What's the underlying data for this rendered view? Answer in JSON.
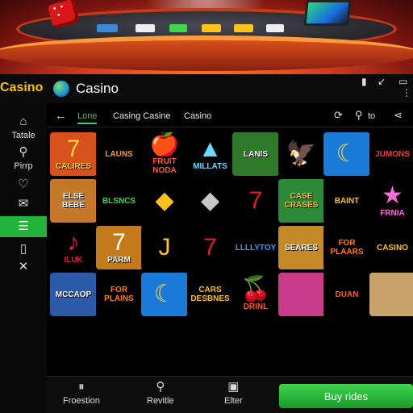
{
  "app": {
    "brand": "Casino",
    "title": "Casino"
  },
  "window": {
    "controls": [
      "▮",
      "↙",
      "▭",
      "⋮"
    ]
  },
  "subnav": {
    "tabs": [
      "Lone",
      "Casing Casine",
      "Casino"
    ],
    "active_tab": 0,
    "search_label": "to"
  },
  "sidebar": {
    "items": [
      {
        "label": "Tatale",
        "icon": "home-icon"
      },
      {
        "label": "Pirrp",
        "icon": "location-pin-icon"
      },
      {
        "label": "",
        "icon": "diamond-icon"
      },
      {
        "label": "",
        "icon": "mail-icon"
      },
      {
        "label": "",
        "icon": "list-icon",
        "active": true
      },
      {
        "label": "",
        "icon": "phone-icon"
      },
      {
        "label": "",
        "icon": "close-icon"
      }
    ]
  },
  "games": [
    {
      "title": "CALIRES",
      "glyph": "7",
      "bg": "#d8501c",
      "fg": "#ffd23a"
    },
    {
      "title": "LAUNS",
      "glyph": "",
      "bg": "#000000",
      "fg": "#ff9a2a"
    },
    {
      "title": "FRUIT NODA",
      "glyph": "🍎",
      "bg": "#000000",
      "fg": "#ff5a2a"
    },
    {
      "title": "MILLATS",
      "glyph": "▲",
      "bg": "#000000",
      "fg": "#6ad8ff"
    },
    {
      "title": "LANIS",
      "glyph": "",
      "bg": "#2f7a2a",
      "fg": "#ffffff"
    },
    {
      "title": "",
      "glyph": "🦅",
      "bg": "#000000",
      "fg": "#c44a1a"
    },
    {
      "title": "",
      "glyph": "☾",
      "bg": "#1a7ad8",
      "fg": "#ffd23a"
    },
    {
      "title": "JUMONS",
      "glyph": "",
      "bg": "#000000",
      "fg": "#ff3a3a"
    },
    {
      "title": "ELSE BEBE",
      "glyph": "",
      "bg": "#c4782a",
      "fg": "#ffffff"
    },
    {
      "title": "BLSNCS",
      "glyph": "",
      "bg": "#000000",
      "fg": "#3ad84a"
    },
    {
      "title": "",
      "glyph": "◆",
      "bg": "#000000",
      "fg": "#ffc21a"
    },
    {
      "title": "",
      "glyph": "◆",
      "bg": "#000000",
      "fg": "#c8c8c8"
    },
    {
      "title": "",
      "glyph": "7",
      "bg": "#000000",
      "fg": "#e81a1a"
    },
    {
      "title": "CASE CRASES",
      "glyph": "",
      "bg": "#2a8a3a",
      "fg": "#ffc21a"
    },
    {
      "title": "BAINT",
      "glyph": "",
      "bg": "#000000",
      "fg": "#ffc21a"
    },
    {
      "title": "FRNIA",
      "glyph": "★",
      "bg": "#000000",
      "fg": "#ff6ad8"
    },
    {
      "title": "ILUK",
      "glyph": "♪",
      "bg": "#000000",
      "fg": "#e81a3a"
    },
    {
      "title": "PARM",
      "glyph": "7",
      "bg": "#c47a1a",
      "fg": "#ffffff"
    },
    {
      "title": "",
      "glyph": "J",
      "bg": "#000000",
      "fg": "#ffc21a"
    },
    {
      "title": "",
      "glyph": "7",
      "bg": "#000000",
      "fg": "#e81a1a"
    },
    {
      "title": "LLLLYTOY",
      "glyph": "",
      "bg": "#000000",
      "fg": "#3a9aff"
    },
    {
      "title": "SEARES",
      "glyph": "",
      "bg": "#c48a2a",
      "fg": "#ffffff"
    },
    {
      "title": "FOR PLAARS",
      "glyph": "",
      "bg": "#000000",
      "fg": "#ff7a1a"
    },
    {
      "title": "CASINO",
      "glyph": "",
      "bg": "#000000",
      "fg": "#ffc21a"
    },
    {
      "title": "MCCAOP",
      "glyph": "",
      "bg": "#2a5aa8",
      "fg": "#ffffff"
    },
    {
      "title": "FOR PLAINS",
      "glyph": "",
      "bg": "#000000",
      "fg": "#ff7a1a"
    },
    {
      "title": "",
      "glyph": "☾",
      "bg": "#1a7ad8",
      "fg": "#ffd23a"
    },
    {
      "title": "CARS DESBNES",
      "glyph": "",
      "bg": "#000000",
      "fg": "#ffc21a"
    },
    {
      "title": "DRINL",
      "glyph": "🍒",
      "bg": "#000000",
      "fg": "#ff5a2a"
    },
    {
      "title": "",
      "glyph": "",
      "bg": "#c83a8a",
      "fg": "#ffffff"
    },
    {
      "title": "DUAN",
      "glyph": "",
      "bg": "#000000",
      "fg": "#ff5a2a"
    },
    {
      "title": "",
      "glyph": "",
      "bg": "#c8a26a",
      "fg": "#ffffff"
    }
  ],
  "bottombar": {
    "items": [
      {
        "label": "Froestion",
        "icon": "pause-icon"
      },
      {
        "label": "Revitle",
        "icon": "wrench-icon"
      },
      {
        "label": "Elter",
        "icon": "camera-icon"
      }
    ],
    "buy_label": "Buy rides"
  }
}
